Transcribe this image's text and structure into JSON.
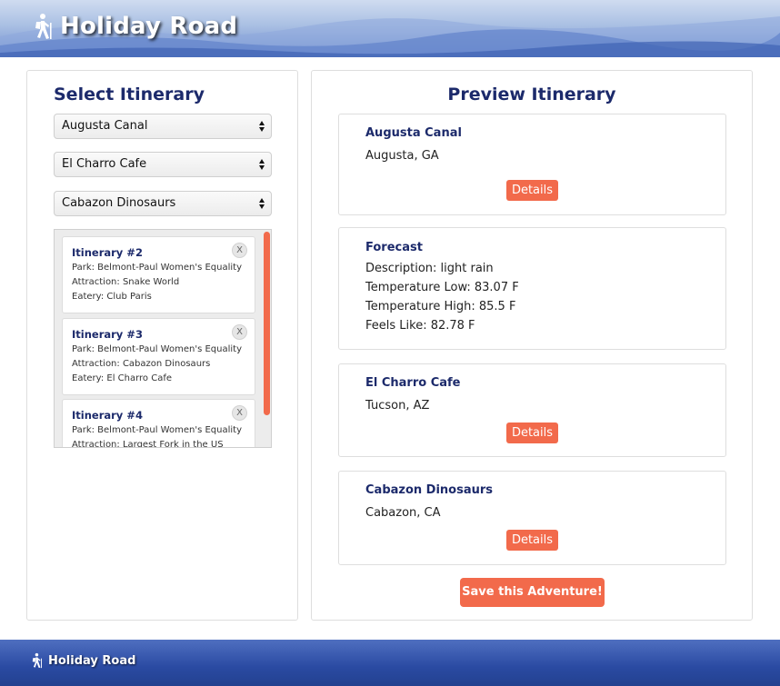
{
  "header": {
    "title": "Holiday Road",
    "icon": "hiker-icon"
  },
  "left_panel": {
    "title": "Select Itinerary",
    "selects": [
      {
        "value": "Augusta Canal"
      },
      {
        "value": "El Charro Cafe"
      },
      {
        "value": "Cabazon Dinosaurs"
      }
    ],
    "itineraries": [
      {
        "title": "Itinerary #2",
        "park": "Park: Belmont-Paul Women's Equality",
        "attraction": "Attraction: Snake World",
        "eatery": "Eatery: Club Paris"
      },
      {
        "title": "Itinerary #3",
        "park": "Park: Belmont-Paul Women's Equality",
        "attraction": "Attraction: Cabazon Dinosaurs",
        "eatery": "Eatery: El Charro Cafe"
      },
      {
        "title": "Itinerary #4",
        "park": "Park: Belmont-Paul Women's Equality",
        "attraction": "Attraction: Largest Fork in the US",
        "eatery": ""
      }
    ],
    "close_label": "X"
  },
  "right_panel": {
    "title": "Preview Itinerary",
    "park": {
      "name": "Augusta Canal",
      "location": "Augusta, GA",
      "details_label": "Details"
    },
    "forecast": {
      "title": "Forecast",
      "description": "Description: light rain",
      "temp_low": "Temperature Low: 83.07 F",
      "temp_high": "Temperature High: 85.5 F",
      "feels_like": "Feels Like: 82.78 F"
    },
    "eatery": {
      "name": "El Charro Cafe",
      "location": "Tucson, AZ",
      "details_label": "Details"
    },
    "attraction": {
      "name": "Cabazon Dinosaurs",
      "location": "Cabazon, CA",
      "details_label": "Details"
    },
    "save_label": "Save this Adventure!"
  },
  "footer": {
    "title": "Holiday Road"
  },
  "colors": {
    "accent": "#f26a4b",
    "title": "#1c2a6b",
    "footer": "#2a4aa2"
  }
}
